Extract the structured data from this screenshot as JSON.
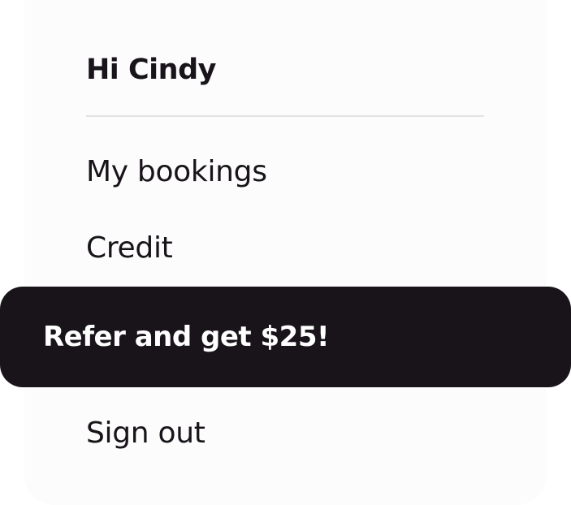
{
  "menu": {
    "greeting": "Hi Cindy",
    "items": [
      {
        "label": "My bookings"
      },
      {
        "label": "Credit"
      },
      {
        "label": "Refer and get $25!"
      },
      {
        "label": "Sign out"
      }
    ]
  },
  "colors": {
    "text": "#18141a",
    "highlight_background": "#18141a",
    "highlight_text": "#ffffff",
    "divider": "#e4e2e4"
  }
}
